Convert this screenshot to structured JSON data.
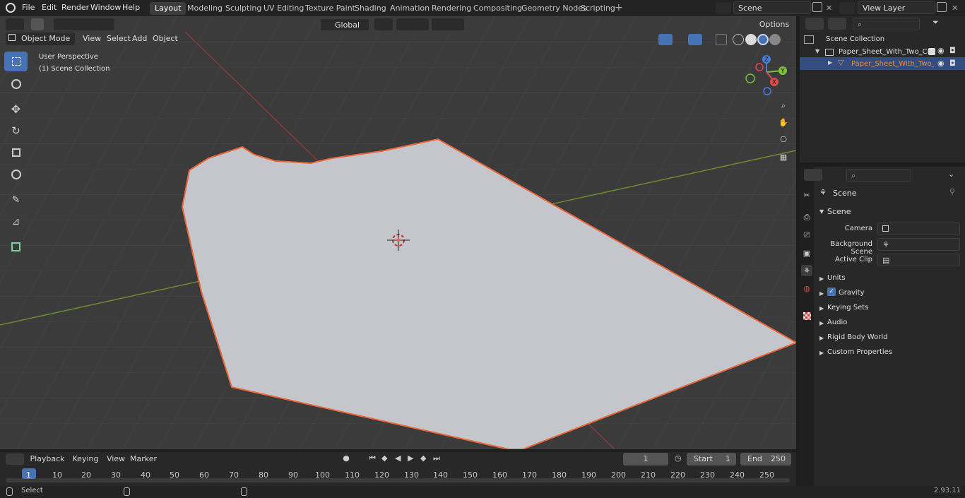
{
  "menus": [
    "File",
    "Edit",
    "Render",
    "Window",
    "Help"
  ],
  "workspaces": [
    "Layout",
    "Modeling",
    "Sculpting",
    "UV Editing",
    "Texture Paint",
    "Shading",
    "Animation",
    "Rendering",
    "Compositing",
    "Geometry Nodes",
    "Scripting"
  ],
  "active_workspace": "Layout",
  "scene_name": "Scene",
  "view_layer": "View Layer",
  "viewport": {
    "mode": "Object Mode",
    "menus": [
      "View",
      "Select",
      "Add",
      "Object"
    ],
    "transform_orientation": "Global",
    "options_label": "Options",
    "perspective_label": "User Perspective",
    "collection_label": "(1) Scene Collection",
    "gizmo_axes": {
      "x": "X",
      "y": "Y",
      "z": "Z"
    }
  },
  "outliner": {
    "root": "Scene Collection",
    "collection": "Paper_Sheet_With_Two_Curle",
    "object": "Paper_Sheet_With_Two_C"
  },
  "properties": {
    "header": "Scene",
    "section": "Scene",
    "camera_label": "Camera",
    "background_scene_label": "Background Scene",
    "active_clip_label": "Active Clip",
    "panels": [
      "Units",
      "Gravity",
      "Keying Sets",
      "Audio",
      "Rigid Body World",
      "Custom Properties"
    ],
    "gravity_enabled": true
  },
  "timeline": {
    "menus": [
      "Playback",
      "Keying",
      "View",
      "Marker"
    ],
    "current_frame": "1",
    "start_label": "Start",
    "start": "1",
    "end_label": "End",
    "end": "250",
    "ticks": [
      "1",
      "10",
      "20",
      "30",
      "40",
      "50",
      "60",
      "70",
      "80",
      "90",
      "100",
      "110",
      "120",
      "130",
      "140",
      "150",
      "160",
      "170",
      "180",
      "190",
      "200",
      "210",
      "220",
      "230",
      "240",
      "250"
    ]
  },
  "status": {
    "select_label": "Select",
    "version": "2.93.11"
  },
  "colors": {
    "accent": "#4772b3",
    "selection_outline": "#e8673a",
    "active_object_text": "#f08a3a",
    "viewport_bg": "#3d3d3d",
    "mesh_face": "#c4c6cb"
  }
}
